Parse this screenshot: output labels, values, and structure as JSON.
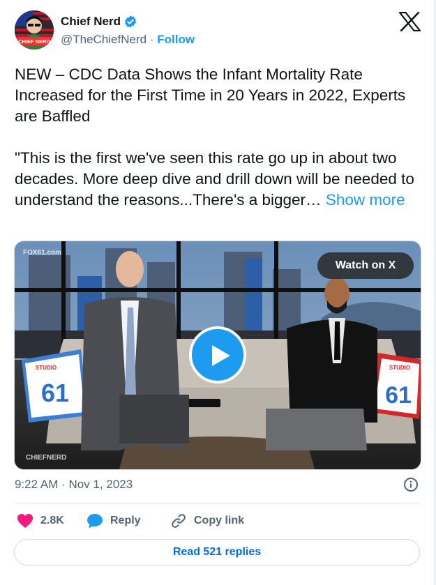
{
  "author": {
    "name": "Chief Nerd",
    "handle": "@TheChiefNerd",
    "separator": "·",
    "follow_label": "Follow",
    "avatar_text": "CHIEF NERD"
  },
  "tweet": {
    "text": "NEW – CDC Data Shows the Infant Mortality Rate Increased for the First Time in 20 Years in 2022, Experts are Baffled\n\n\"This is the first we've seen this rate go up in about two decades. More deep dive and drill down will be needed to understand the reasons...There's a bigger… ",
    "show_more": "Show more"
  },
  "media": {
    "watch_label": "Watch on X",
    "channel_watermark": "FOX61.com",
    "credit_watermark": "CHIEFNERD",
    "pillow_text_left": "STUDIO",
    "pillow_number_left": "61",
    "pillow_text_right": "STUDIO",
    "pillow_number_right": "61"
  },
  "meta": {
    "time": "9:22 AM",
    "separator": "·",
    "date": "Nov 1, 2023"
  },
  "actions": {
    "likes": "2.8K",
    "reply_label": "Reply",
    "copy_label": "Copy link",
    "read_replies": "Read 521 replies"
  },
  "colors": {
    "accent": "#1d9bf0",
    "like": "#f91880",
    "text": "#0f1419",
    "muted": "#536471"
  }
}
